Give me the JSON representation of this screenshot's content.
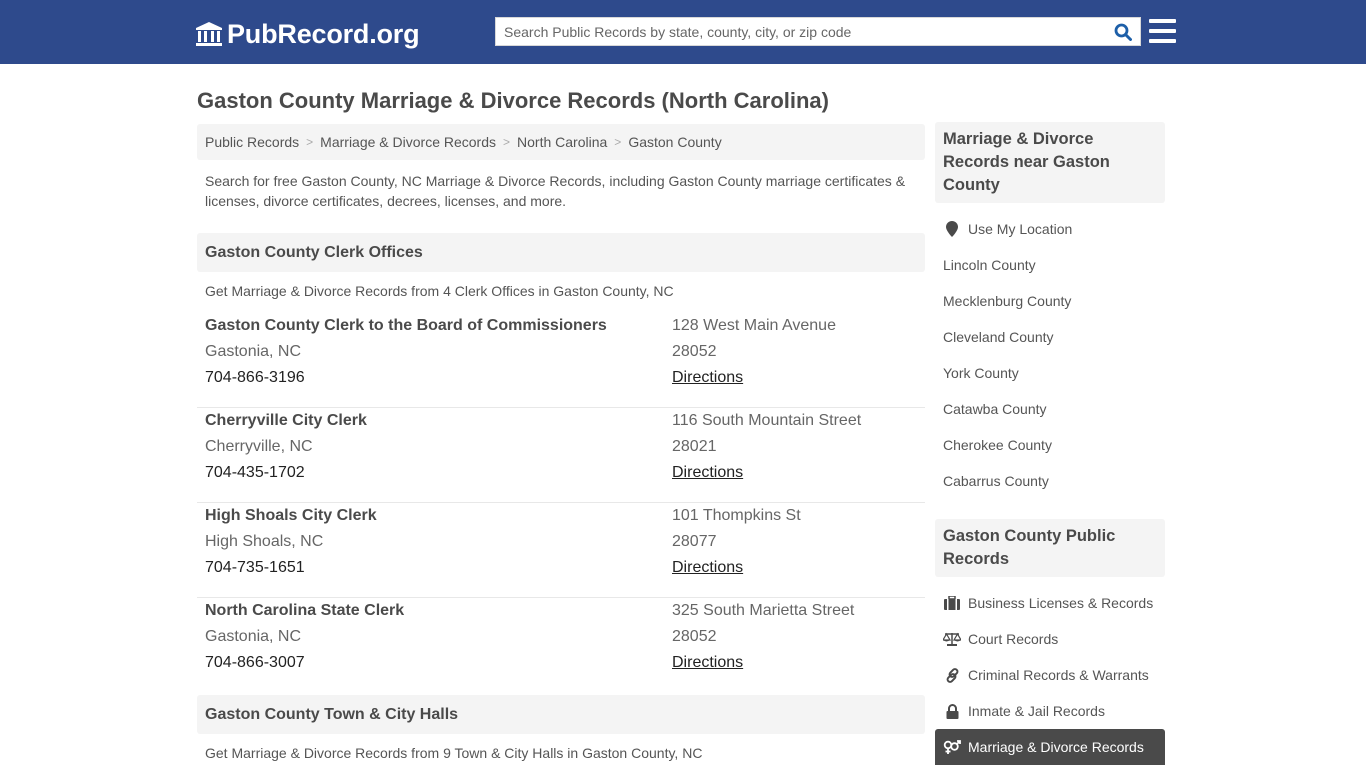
{
  "header": {
    "logo_text": "PubRecord.org",
    "search_placeholder": "Search Public Records by state, county, city, or zip code",
    "brand_color": "#2e4a8c"
  },
  "page_title": "Gaston County Marriage & Divorce Records (North Carolina)",
  "breadcrumb": [
    "Public Records",
    "Marriage & Divorce Records",
    "North Carolina",
    "Gaston County"
  ],
  "intro": "Search for free Gaston County, NC Marriage & Divorce Records, including Gaston County marriage certificates & licenses, divorce certificates, decrees, licenses, and more.",
  "clerk_section": {
    "title": "Gaston County Clerk Offices",
    "description": "Get Marriage & Divorce Records from 4 Clerk Offices in Gaston County, NC",
    "offices": [
      {
        "name": "Gaston County Clerk to the Board of Commissioners",
        "city": "Gastonia, NC",
        "phone": "704-866-3196",
        "address": "128 West Main Avenue",
        "zip": "28052",
        "directions": "Directions"
      },
      {
        "name": "Cherryville City Clerk",
        "city": "Cherryville, NC",
        "phone": "704-435-1702",
        "address": "116 South Mountain Street",
        "zip": "28021",
        "directions": "Directions"
      },
      {
        "name": "High Shoals City Clerk",
        "city": "High Shoals, NC",
        "phone": "704-735-1651",
        "address": "101 Thompkins St",
        "zip": "28077",
        "directions": "Directions"
      },
      {
        "name": "North Carolina State Clerk",
        "city": "Gastonia, NC",
        "phone": "704-866-3007",
        "address": "325 South Marietta Street",
        "zip": "28052",
        "directions": "Directions"
      }
    ]
  },
  "town_section": {
    "title": "Gaston County Town & City Halls",
    "description": "Get Marriage & Divorce Records from 9 Town & City Halls in Gaston County, NC"
  },
  "sidebar": {
    "nearby_title": "Marriage & Divorce Records near Gaston County",
    "use_location": {
      "label": "Use My Location",
      "icon": "map-marker-icon"
    },
    "nearby": [
      "Lincoln County",
      "Mecklenburg County",
      "Cleveland County",
      "York County",
      "Catawba County",
      "Cherokee County",
      "Cabarrus County"
    ],
    "public_title": "Gaston County Public Records",
    "public_records": [
      {
        "label": "Business Licenses & Records",
        "icon": "briefcase-icon"
      },
      {
        "label": "Court Records",
        "icon": "balance-scale-icon"
      },
      {
        "label": "Criminal Records & Warrants",
        "icon": "link-icon"
      },
      {
        "label": "Inmate & Jail Records",
        "icon": "lock-icon"
      },
      {
        "label": "Marriage & Divorce Records",
        "icon": "venus-mars-icon",
        "active": true
      }
    ]
  }
}
